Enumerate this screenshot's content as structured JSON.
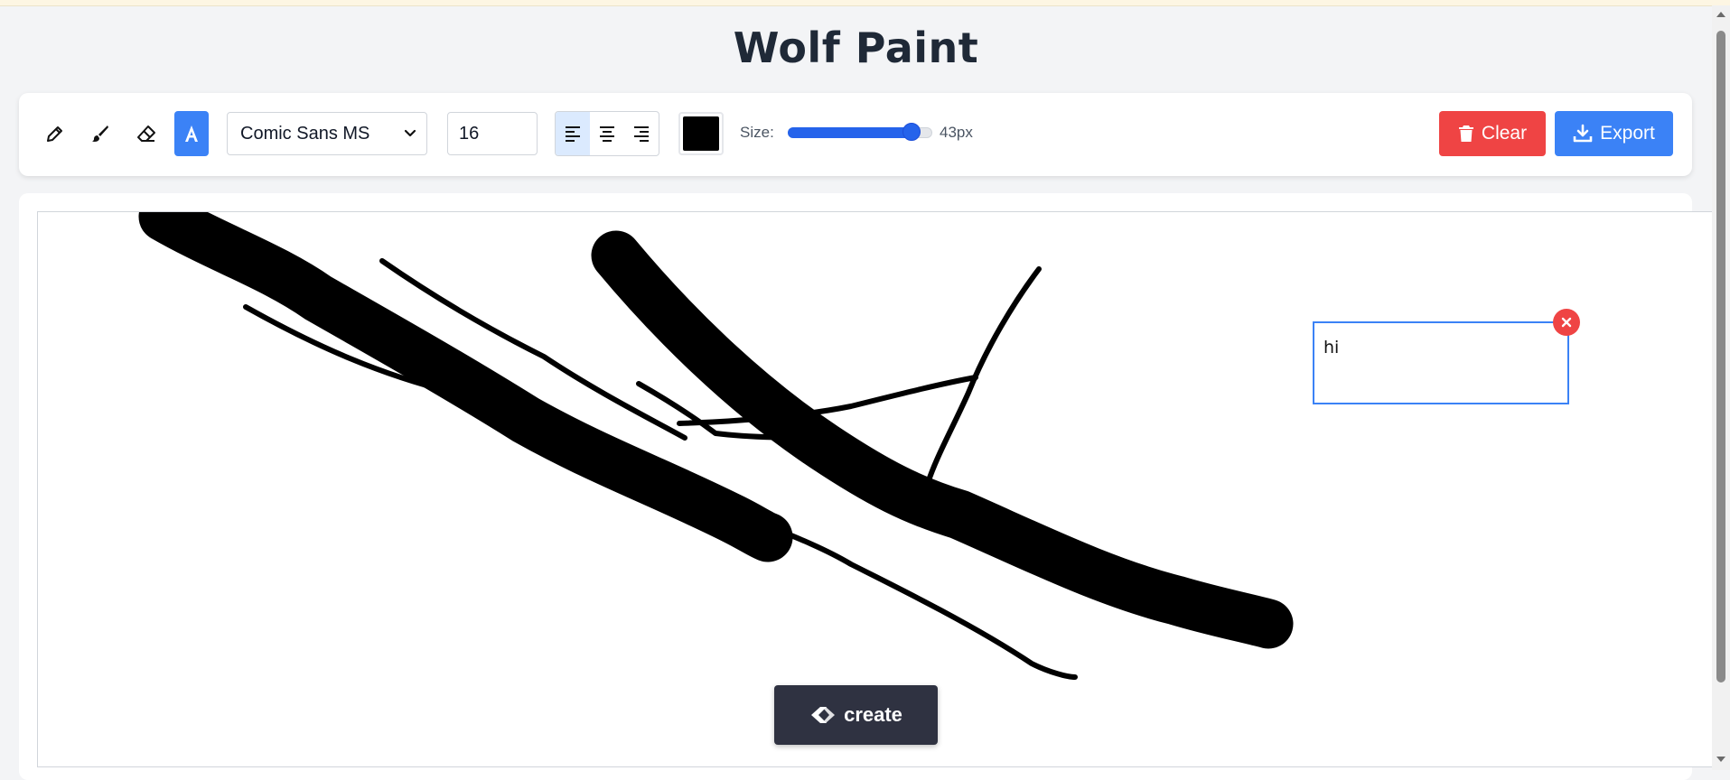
{
  "app": {
    "title": "Wolf Paint"
  },
  "toolbar": {
    "tools": [
      {
        "name": "pencil",
        "icon": "pencil-icon",
        "active": false
      },
      {
        "name": "brush",
        "icon": "brush-icon",
        "active": false
      },
      {
        "name": "eraser",
        "icon": "eraser-icon",
        "active": false
      },
      {
        "name": "text",
        "icon": "text-tool-icon",
        "active": true
      }
    ],
    "font": {
      "selected": "Comic Sans MS"
    },
    "font_size": {
      "value": "16"
    },
    "alignment": {
      "options": [
        "left",
        "center",
        "right"
      ],
      "selected": "left"
    },
    "color": {
      "value": "#000000"
    },
    "size": {
      "label": "Size:",
      "value": 43,
      "min": 1,
      "max": 50,
      "display": "43px"
    },
    "clear_label": "Clear",
    "export_label": "Export"
  },
  "canvas": {
    "text_box": {
      "content": "hi"
    },
    "create_label": "create"
  },
  "colors": {
    "accent": "#3b82f6",
    "danger": "#ef4444",
    "title": "#1f2937",
    "create_bg": "#2f3241"
  }
}
